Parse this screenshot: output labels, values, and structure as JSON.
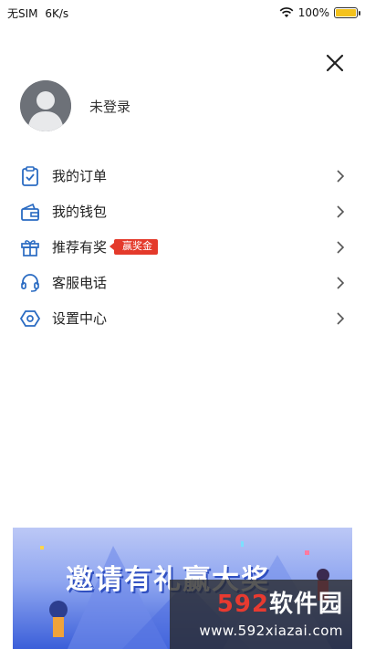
{
  "status_bar": {
    "carrier": "无SIM",
    "speed": "6K/s",
    "battery_percent": "100%",
    "battery_level": 1.0,
    "battery_color": "#f4c21c"
  },
  "profile": {
    "login_status": "未登录"
  },
  "menu": {
    "items": [
      {
        "label": "我的订单",
        "icon": "order-clipboard-icon"
      },
      {
        "label": "我的钱包",
        "icon": "wallet-icon"
      },
      {
        "label": "推荐有奖",
        "icon": "gift-icon",
        "badge": "赢奖金"
      },
      {
        "label": "客服电话",
        "icon": "headset-icon"
      },
      {
        "label": "设置中心",
        "icon": "settings-hexagon-icon"
      }
    ]
  },
  "banner": {
    "title": "邀请有礼赢大奖"
  },
  "watermark": {
    "brand_num": "592",
    "brand_text": "软件园",
    "url": "www.592xiazai.com"
  },
  "colors": {
    "accent_icon": "#2a6bc2",
    "badge": "#e43a2b"
  }
}
